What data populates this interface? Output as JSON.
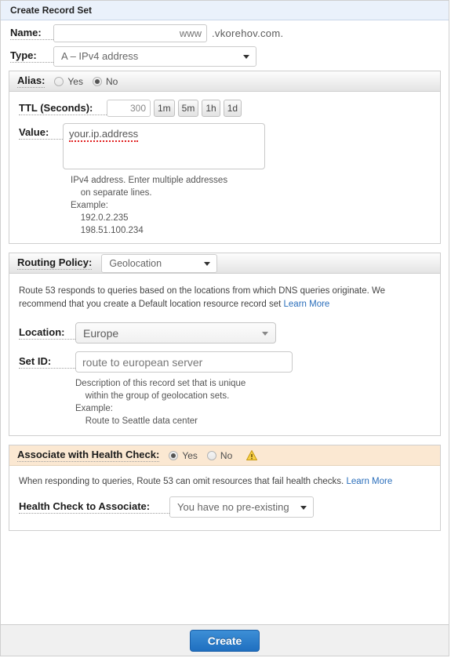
{
  "header": {
    "title": "Create Record Set"
  },
  "name": {
    "label": "Name:",
    "value": "www",
    "placeholder": "www",
    "suffix": ".vkorehov.com."
  },
  "type": {
    "label": "Type:",
    "value": "A – IPv4 address"
  },
  "alias": {
    "label": "Alias:",
    "yes_label": "Yes",
    "no_label": "No",
    "selected": "No"
  },
  "ttl": {
    "label": "TTL (Seconds):",
    "value": "300",
    "buttons": [
      "1m",
      "5m",
      "1h",
      "1d"
    ]
  },
  "value": {
    "label": "Value:",
    "text": "your.ip.address",
    "hint": "IPv4 address. Enter multiple addresses\n    on separate lines.\nExample:\n    192.0.2.235\n    198.51.100.234"
  },
  "routing": {
    "label": "Routing Policy:",
    "value": "Geolocation",
    "description": "Route 53 responds to queries based on the locations from which DNS queries originate. We recommend that you create a Default location resource record set",
    "learn_more": "Learn More",
    "location_label": "Location:",
    "location_value": "Europe",
    "setid_label": "Set ID:",
    "setid_value": "route to european server",
    "setid_hint": "Description of this record set that is unique\n    within the group of geolocation sets.\nExample:\n    Route to Seattle data center"
  },
  "health_check": {
    "label": "Associate with Health Check:",
    "yes_label": "Yes",
    "no_label": "No",
    "selected": "Yes",
    "warning_icon": "warning-triangle-icon",
    "description": "When responding to queries, Route 53 can omit resources that fail health checks.",
    "learn_more": "Learn More",
    "associate_label": "Health Check to Associate:",
    "associate_value": "You have no pre-existing"
  },
  "footer": {
    "create_label": "Create"
  },
  "colors": {
    "header_bg": "#eaf1fb",
    "peach_bg": "#fbe8d2",
    "link": "#2a6ebb",
    "button": "#1f6fc0",
    "warning": "#f5c242"
  }
}
